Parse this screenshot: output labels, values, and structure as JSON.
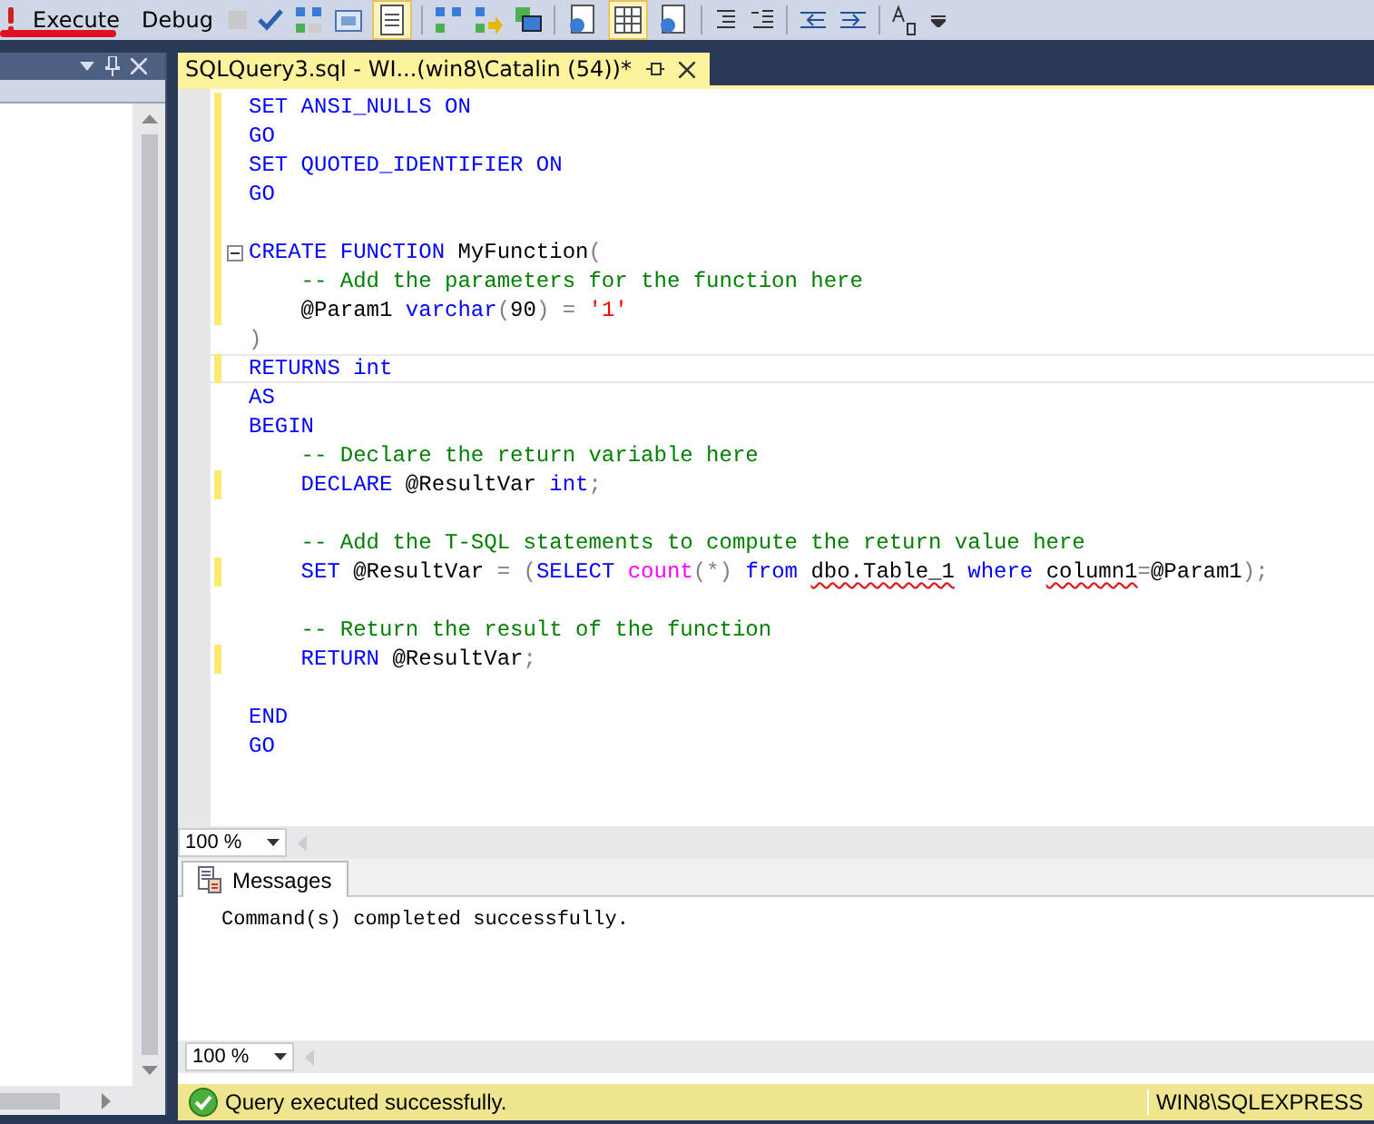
{
  "toolbar": {
    "buttons": [
      {
        "label": "Execute"
      },
      {
        "label": "Debug"
      }
    ]
  },
  "editor_tab": {
    "title": "SQLQuery3.sql - WI...(win8\\Catalin (54))*"
  },
  "code": [
    {
      "modified": true,
      "fold": false,
      "current": false,
      "tokens": [
        {
          "kind": "keyword",
          "text": "SET ANSI_NULLS ON"
        }
      ]
    },
    {
      "modified": true,
      "fold": false,
      "current": false,
      "tokens": [
        {
          "kind": "keyword",
          "text": "GO"
        }
      ]
    },
    {
      "modified": true,
      "fold": false,
      "current": false,
      "tokens": [
        {
          "kind": "keyword",
          "text": "SET QUOTED_IDENTIFIER ON"
        }
      ]
    },
    {
      "modified": true,
      "fold": false,
      "current": false,
      "tokens": [
        {
          "kind": "keyword",
          "text": "GO"
        }
      ]
    },
    {
      "modified": true,
      "fold": false,
      "current": false
    },
    {
      "modified": true,
      "fold": true,
      "current": false,
      "tokens": [
        {
          "kind": "keyword",
          "text": "CREATE FUNCTION "
        },
        {
          "kind": "plain",
          "text": "MyFunction"
        },
        {
          "kind": "operator",
          "text": "("
        }
      ]
    },
    {
      "modified": true,
      "fold": false,
      "current": false,
      "tokens": [
        {
          "kind": "comment",
          "text": "    -- Add the parameters for the function here"
        }
      ]
    },
    {
      "modified": true,
      "fold": false,
      "current": false,
      "tokens": [
        {
          "kind": "plain",
          "text": "    @Param1 "
        },
        {
          "kind": "keyword",
          "text": "varchar"
        },
        {
          "kind": "operator",
          "text": "("
        },
        {
          "kind": "plain",
          "text": "90"
        },
        {
          "kind": "operator",
          "text": ") = "
        },
        {
          "kind": "string",
          "text": "'1'"
        }
      ]
    },
    {
      "modified": false,
      "fold": false,
      "current": false,
      "tokens": [
        {
          "kind": "operator",
          "text": ")"
        }
      ]
    },
    {
      "modified": true,
      "fold": false,
      "current": true,
      "tokens": [
        {
          "kind": "keyword",
          "text": "RETURNS int"
        }
      ]
    },
    {
      "modified": false,
      "fold": false,
      "current": false,
      "tokens": [
        {
          "kind": "keyword",
          "text": "AS"
        }
      ]
    },
    {
      "modified": false,
      "fold": false,
      "current": false,
      "tokens": [
        {
          "kind": "keyword",
          "text": "BEGIN"
        }
      ]
    },
    {
      "modified": false,
      "fold": false,
      "current": false,
      "tokens": [
        {
          "kind": "comment",
          "text": "    -- Declare the return variable here"
        }
      ]
    },
    {
      "modified": true,
      "fold": false,
      "current": false,
      "tokens": [
        {
          "kind": "keyword",
          "text": "    DECLARE "
        },
        {
          "kind": "plain",
          "text": "@ResultVar "
        },
        {
          "kind": "keyword",
          "text": "int"
        },
        {
          "kind": "operator",
          "text": ";"
        }
      ]
    },
    {
      "modified": false,
      "fold": false,
      "current": false
    },
    {
      "modified": false,
      "fold": false,
      "current": false,
      "tokens": [
        {
          "kind": "comment",
          "text": "    -- Add the T-SQL statements to compute the return value here"
        }
      ]
    },
    {
      "modified": true,
      "fold": false,
      "current": false,
      "tokens": [
        {
          "kind": "keyword",
          "text": "    SET "
        },
        {
          "kind": "plain",
          "text": "@ResultVar "
        },
        {
          "kind": "operator",
          "text": "= ("
        },
        {
          "kind": "keyword",
          "text": "SELECT "
        },
        {
          "kind": "function",
          "text": "count"
        },
        {
          "kind": "operator",
          "text": "(*) "
        },
        {
          "kind": "keyword",
          "text": "from "
        },
        {
          "kind": "error",
          "text": "dbo.Table_1"
        },
        {
          "kind": "keyword",
          "text": " where "
        },
        {
          "kind": "error",
          "text": "column1"
        },
        {
          "kind": "operator",
          "text": "="
        },
        {
          "kind": "plain",
          "text": "@Param1"
        },
        {
          "kind": "operator",
          "text": ");"
        }
      ]
    },
    {
      "modified": false,
      "fold": false,
      "current": false
    },
    {
      "modified": false,
      "fold": false,
      "current": false,
      "tokens": [
        {
          "kind": "comment",
          "text": "    -- Return the result of the function"
        }
      ]
    },
    {
      "modified": true,
      "fold": false,
      "current": false,
      "tokens": [
        {
          "kind": "keyword",
          "text": "    RETURN "
        },
        {
          "kind": "plain",
          "text": "@ResultVar"
        },
        {
          "kind": "operator",
          "text": ";"
        }
      ]
    },
    {
      "modified": false,
      "fold": false,
      "current": false
    },
    {
      "modified": false,
      "fold": false,
      "current": false,
      "tokens": [
        {
          "kind": "keyword",
          "text": "END"
        }
      ]
    },
    {
      "modified": false,
      "fold": false,
      "current": false,
      "tokens": [
        {
          "kind": "keyword",
          "text": "GO"
        }
      ]
    }
  ],
  "editor_zoom": "100 %",
  "results": {
    "tab": {
      "label": "Messages",
      "selected": true
    },
    "message": "Command(s) completed successfully.",
    "zoom": "100 %"
  },
  "status_bar": {
    "message": "Query executed successfully.",
    "server": "WIN8\\SQLEXPRESS"
  }
}
